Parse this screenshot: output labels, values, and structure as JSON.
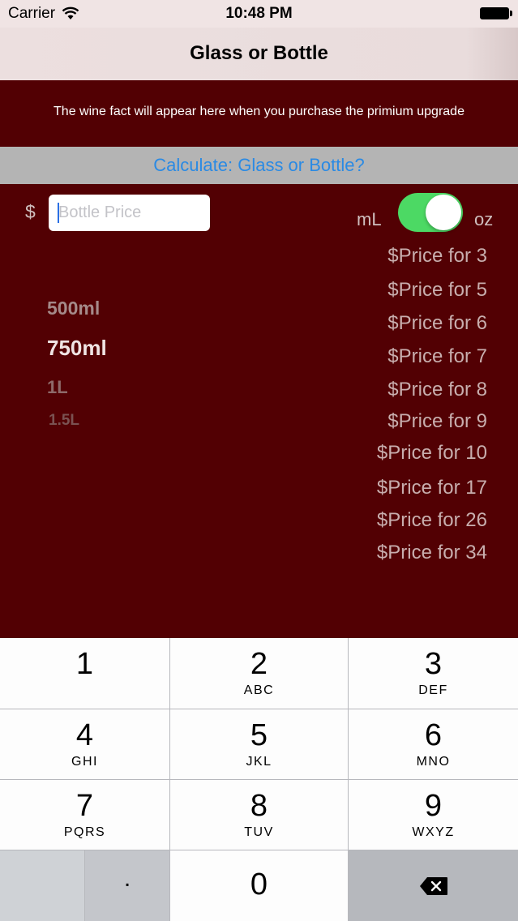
{
  "status_bar": {
    "carrier": "Carrier",
    "time": "10:48 PM"
  },
  "nav": {
    "title": "Glass or Bottle"
  },
  "fact": {
    "text": "The wine fact will appear here when you purchase the primium upgrade"
  },
  "calc_button": {
    "label": "Calculate: Glass or Bottle?"
  },
  "price": {
    "currency_symbol": "$",
    "placeholder": "Bottle Price",
    "value": ""
  },
  "unit_toggle": {
    "left_label": "mL",
    "right_label": "oz",
    "state": "on",
    "on_color": "#4cd964"
  },
  "size_picker": {
    "options": [
      "500ml",
      "750ml",
      "1L",
      "1.5L"
    ],
    "selected": "750ml"
  },
  "price_labels": [
    "$Price for 3",
    "$Price for 5",
    "$Price for 6",
    "$Price for 7",
    "$Price for 8",
    "$Price for 9",
    "$Price for 10",
    "$Price for 17",
    "$Price for 26",
    "$Price for 34"
  ],
  "keypad": {
    "keys": [
      {
        "num": "1",
        "letters": ""
      },
      {
        "num": "2",
        "letters": "ABC"
      },
      {
        "num": "3",
        "letters": "DEF"
      },
      {
        "num": "4",
        "letters": "GHI"
      },
      {
        "num": "5",
        "letters": "JKL"
      },
      {
        "num": "6",
        "letters": "MNO"
      },
      {
        "num": "7",
        "letters": "PQRS"
      },
      {
        "num": "8",
        "letters": "TUV"
      },
      {
        "num": "9",
        "letters": "WXYZ"
      }
    ],
    "dot": ".",
    "zero": "0"
  },
  "colors": {
    "background": "#520003",
    "accent_link": "#2a8ae4",
    "calc_bar": "#b4b4b4"
  }
}
